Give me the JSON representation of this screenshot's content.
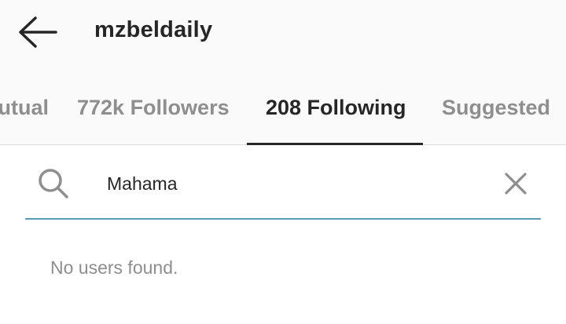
{
  "header": {
    "title": "mzbeldaily",
    "back_icon": "arrow-left-icon"
  },
  "tabs": [
    {
      "label": "Mutual",
      "active": false
    },
    {
      "label": "772k Followers",
      "active": false
    },
    {
      "label": "208 Following",
      "active": true
    },
    {
      "label": "Suggested",
      "active": false
    }
  ],
  "search": {
    "value": "Mahama",
    "icon": "search-icon",
    "clear_icon": "close-icon",
    "underline_color": "#5a9ab5"
  },
  "results": {
    "empty_message": "No users found."
  },
  "colors": {
    "primary_text": "#262626",
    "secondary_text": "#8e8e8e",
    "header_bg": "#fafafa"
  }
}
